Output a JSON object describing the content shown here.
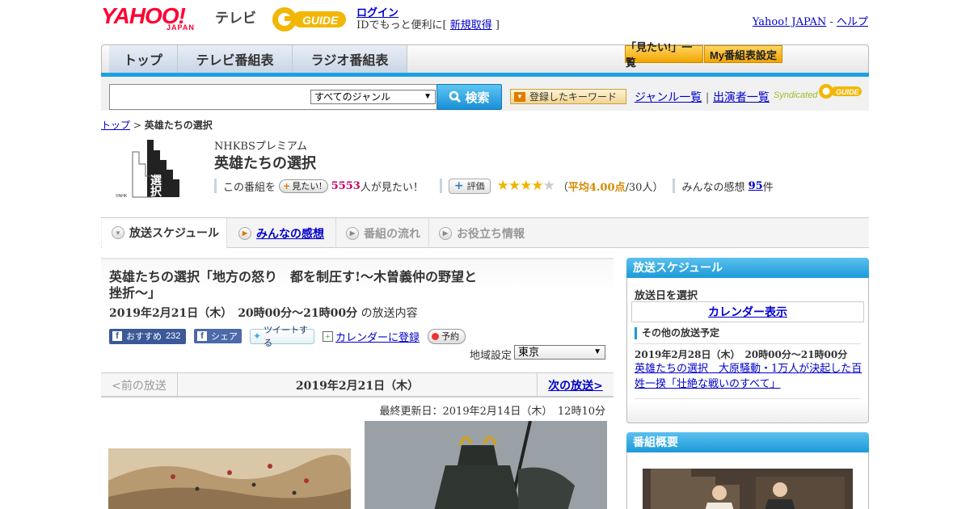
{
  "header": {
    "logo_yahoo": "YAHOO!",
    "logo_japan": "JAPAN",
    "logo_tv": "テレビ",
    "gguide": "G-GUIDE",
    "login": "ログイン",
    "login_prefix": "IDでもっと便利に[ ",
    "signup": "新規取得",
    "login_suffix": " ]",
    "yahoo_japan": "Yahoo! JAPAN",
    "sep": " - ",
    "help": "ヘルプ"
  },
  "global_nav": {
    "tabs": [
      "トップ",
      "テレビ番組表",
      "ラジオ番組表"
    ],
    "mitai_list": "「見たい!」一覧",
    "my_schedule": "My番組表設定"
  },
  "search": {
    "placeholder": "",
    "genre": "すべてのジャンル",
    "button": "検索",
    "keyword_button": "登録したキーワード",
    "genre_list": "ジャンル一覧",
    "divider": "|",
    "cast_list": "出演者一覧",
    "syndicated": "Syndicated",
    "gguide_small": "G-GUIDE"
  },
  "breadcrumb": {
    "home": "トップ",
    "sep": " > ",
    "current": "英雄たちの選択"
  },
  "program": {
    "thumb_text": "英雄たちの選択",
    "thumb_credit": "©NHK",
    "channel": "NHKBSプレミアム",
    "title": "英雄たちの選択",
    "watch_prefix": "この番組を",
    "mitai_btn": "見たい!",
    "watch_count": "5553",
    "watch_suffix": "人が見たい！",
    "rate_btn": "評価",
    "rating": 4,
    "avg_prefix": "（",
    "avg_text": "平均4.00点",
    "avg_suffix": "/30人）",
    "comments_prefix": "みんなの感想",
    "comments_count": "95",
    "comments_suffix": "件"
  },
  "program_tabs": [
    {
      "label": "放送スケジュール"
    },
    {
      "label": "みんなの感想"
    },
    {
      "label": "番組の流れ"
    },
    {
      "label": "お役立ち情報"
    }
  ],
  "episode": {
    "title": "英雄たちの選択「地方の怒り　都を制圧す!～木曽義仲の野望と挫折～」",
    "date": "2019年2月21日（木）　20時00分～21時00分",
    "date_suffix": "の放送内容",
    "fb_like": "おすすめ",
    "fb_count": "232",
    "fb_share": "シェア",
    "tweet": "ツイートする",
    "calendar": "カレンダーに登録",
    "reserve": "予約",
    "region_label": "地域設定",
    "region": "東京"
  },
  "pager": {
    "prev": "<前の放送",
    "current": "2019年2月21日（木）",
    "next": "次の放送>"
  },
  "updated": "最終更新日：2019年2月14日（木）　12時10分",
  "sidebar": {
    "schedule_title": "放送スケジュール",
    "select_date": "放送日を選択",
    "calendar_btn": "カレンダー表示",
    "other_title": "その他の放送予定",
    "other_date": "2019年2月28日（木）　20時00分～21時00分",
    "other_link": "英雄たちの選択　大原騒動・1万人が決起した百姓一揆「壮絶な戦いのすべて」",
    "overview_title": "番組概要"
  },
  "colors": {
    "accent_blue": "#1ba1e2",
    "link": "#0000cc",
    "yahoo_red": "#ff0033",
    "star": "#f0b400"
  }
}
